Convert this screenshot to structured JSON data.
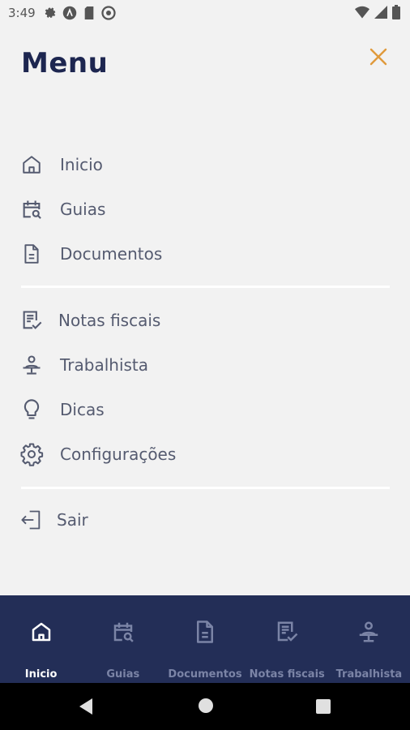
{
  "status_bar": {
    "time": "3:49"
  },
  "header": {
    "title": "Menu",
    "close_icon": "close-icon"
  },
  "menu": {
    "group1": [
      {
        "label": "Inicio",
        "icon": "home-icon"
      },
      {
        "label": "Guias",
        "icon": "calendar-search-icon"
      },
      {
        "label": "Documentos",
        "icon": "document-icon"
      }
    ],
    "group2": [
      {
        "label": "Notas fiscais",
        "icon": "invoice-check-icon"
      },
      {
        "label": "Trabalhista",
        "icon": "worker-icon"
      },
      {
        "label": "Dicas",
        "icon": "lightbulb-icon"
      },
      {
        "label": "Configurações",
        "icon": "gear-icon"
      }
    ],
    "group3": [
      {
        "label": "Sair",
        "icon": "logout-icon"
      }
    ]
  },
  "bottom_nav": {
    "active": "Inicio",
    "tabs": [
      {
        "label": "Inicio",
        "icon": "home-icon"
      },
      {
        "label": "Guias",
        "icon": "calendar-search-icon"
      },
      {
        "label": "Documentos",
        "icon": "document-icon"
      },
      {
        "label": "Notas fiscais",
        "icon": "invoice-check-icon"
      },
      {
        "label": "Trabalhista",
        "icon": "worker-icon"
      }
    ]
  },
  "colors": {
    "title": "#1d2650",
    "close": "#e09a3c",
    "menu_text": "#555b70",
    "nav_bg": "#232e57",
    "nav_active": "#ffffff",
    "nav_inactive": "#7b84a6"
  }
}
